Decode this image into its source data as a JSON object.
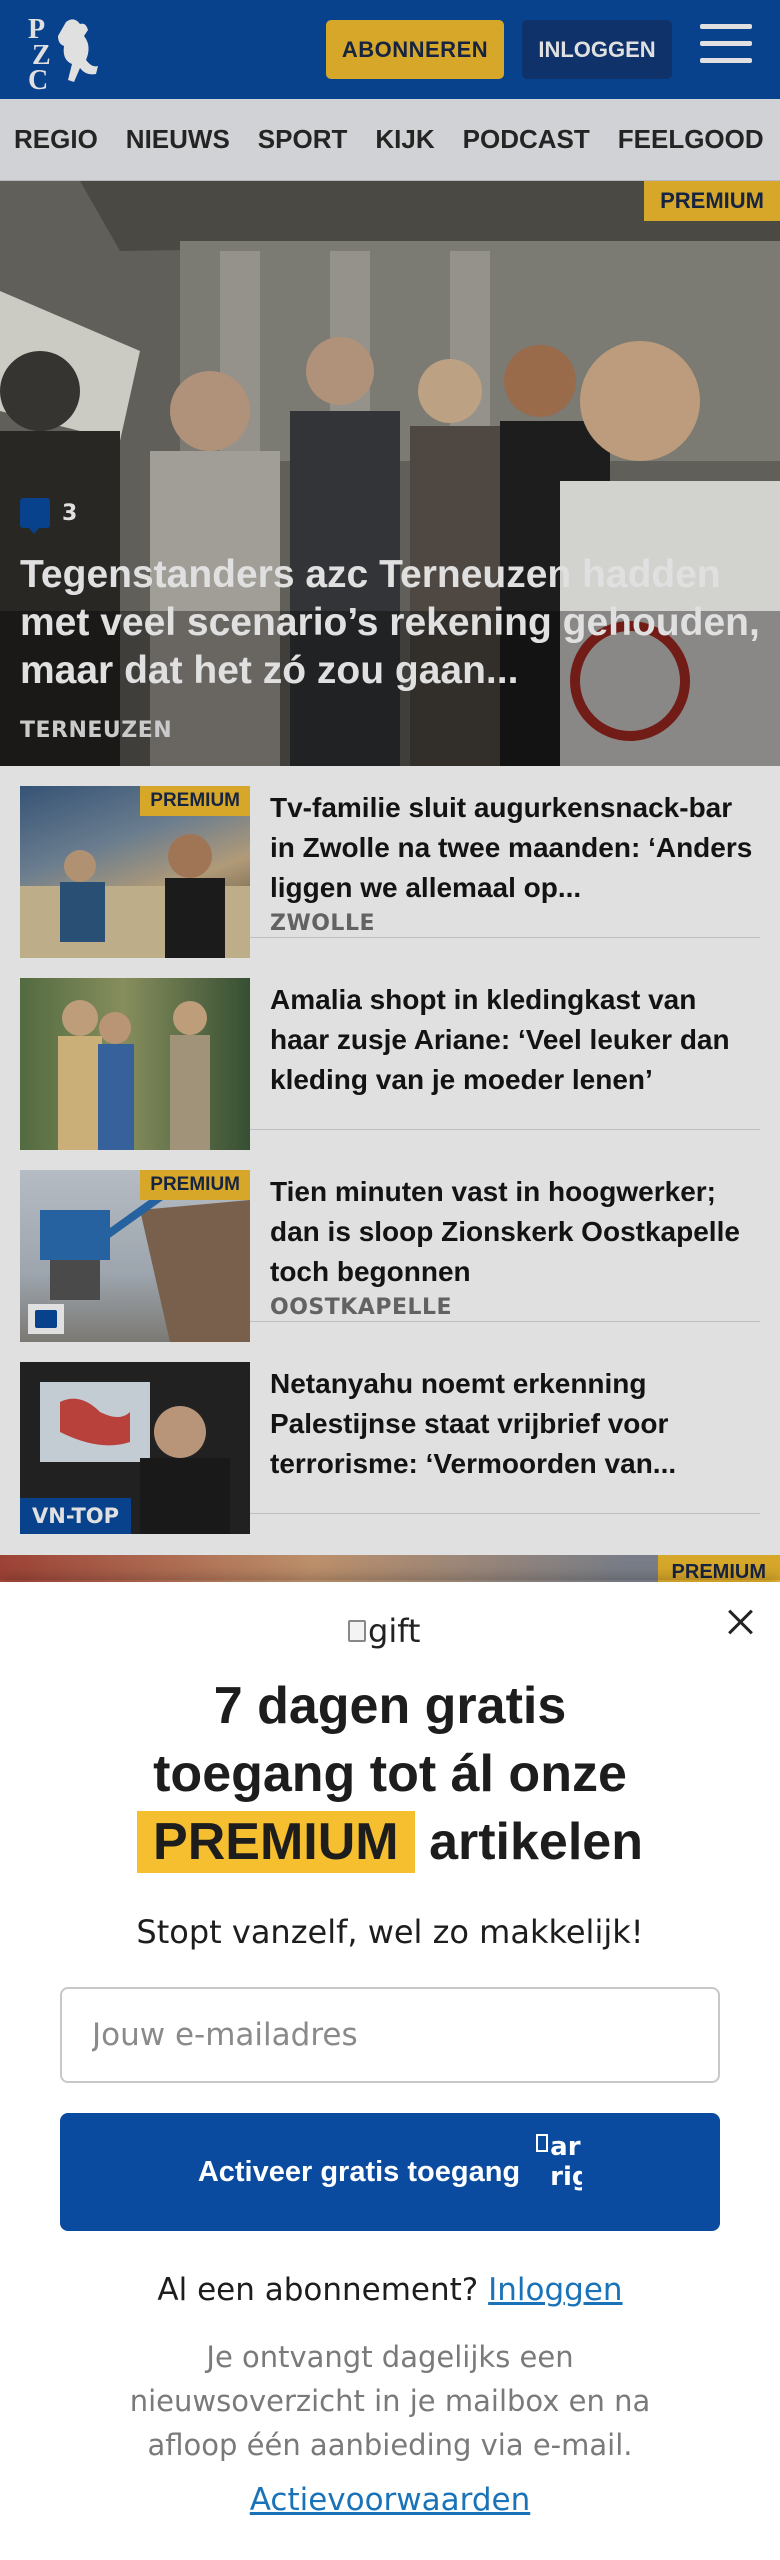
{
  "header": {
    "subscribe_label": "ABONNEREN",
    "login_label": "INLOGGEN",
    "logo_text": "PZC"
  },
  "nav": {
    "items": [
      "REGIO",
      "NIEUWS",
      "SPORT",
      "KIJK",
      "PODCAST",
      "FEELGOOD"
    ]
  },
  "hero": {
    "premium_label": "PREMIUM",
    "comment_count": "3",
    "title": "Tegenstanders azc Terneuzen hadden met veel scenario’s rekening gehouden, maar dat het zó zou gaan...",
    "location": "TERNEUZEN"
  },
  "articles": [
    {
      "title": "Tv-familie sluit augurkensnack-bar in Zwolle na twee maanden: ‘Anders liggen we allemaal op...",
      "location": "ZWOLLE",
      "premium_label": "PREMIUM"
    },
    {
      "title": "Amalia shopt in kledingkast van haar zusje Ariane: ‘Veel leuker dan kleding van je moeder lenen’",
      "location": ""
    },
    {
      "title": "Tien minuten vast in hoogwerker; dan is sloop Zionskerk Oostkapelle toch begonnen",
      "location": "OOSTKAPELLE",
      "premium_label": "PREMIUM"
    },
    {
      "title": "Netanyahu noemt erkenning Palestijnse staat vrijbrief voor terrorisme: ‘Vermoorden van...",
      "location": "",
      "tag": "VN-TOP"
    }
  ],
  "peek_premium_label": "PREMIUM",
  "modal": {
    "gift_alt": "gift",
    "heading_line1": "7 dagen gratis",
    "heading_line2": "toegang tot ál onze",
    "heading_premium": "PREMIUM",
    "heading_tail": "artikelen",
    "subheading": "Stopt vanzelf, wel zo makkelijk!",
    "email_placeholder": "Jouw e-mailadres",
    "cta_label": "Activeer gratis toegang",
    "cta_icon_alt": "arrow-right",
    "account_prefix": "Al een abonnement?",
    "account_link": "Inloggen",
    "info_text": "Je ontvangt dagelijks een nieuwsoverzicht in je mailbox en na afloop één aanbieding via e-mail.",
    "terms_link": "Actievoorwaarden"
  },
  "colors": {
    "brand_blue": "#0a4ba0",
    "premium_yellow": "#f5bf30"
  }
}
